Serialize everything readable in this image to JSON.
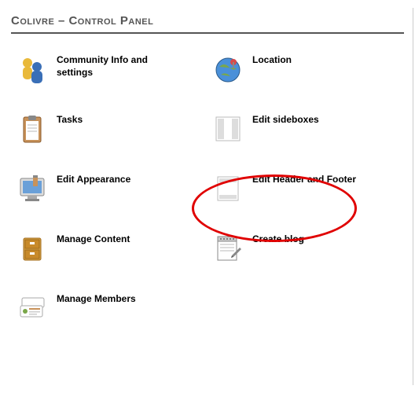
{
  "header": {
    "title": "Colivre – Control Panel"
  },
  "items": [
    {
      "label": "Community Info and settings",
      "name": "community-info-item",
      "icon": "people-icon"
    },
    {
      "label": "Location",
      "name": "location-item",
      "icon": "globe-icon"
    },
    {
      "label": "Tasks",
      "name": "tasks-item",
      "icon": "clipboard-icon"
    },
    {
      "label": "Edit sideboxes",
      "name": "edit-sideboxes-item",
      "icon": "sideboxes-icon"
    },
    {
      "label": "Edit Appearance",
      "name": "edit-appearance-item",
      "icon": "appearance-icon"
    },
    {
      "label": "Edit Header and Footer",
      "name": "edit-header-footer-item",
      "icon": "header-footer-icon"
    },
    {
      "label": "Manage Content",
      "name": "manage-content-item",
      "icon": "drawer-icon"
    },
    {
      "label": "Create blog",
      "name": "create-blog-item",
      "icon": "notepad-icon"
    },
    {
      "label": "Manage Members",
      "name": "manage-members-item",
      "icon": "members-icon"
    }
  ]
}
